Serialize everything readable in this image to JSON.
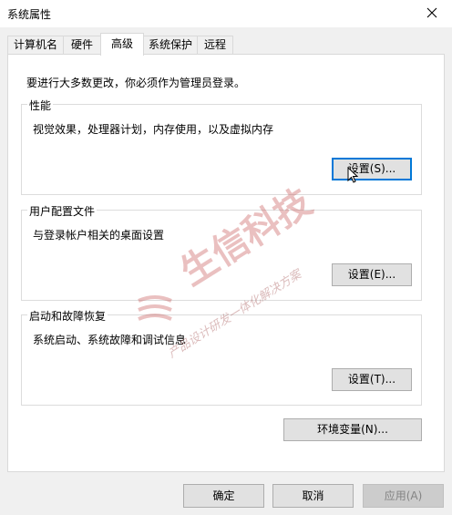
{
  "window": {
    "title": "系统属性",
    "close_glyph": "✕"
  },
  "tabs": [
    {
      "label": "计算机名",
      "active": false
    },
    {
      "label": "硬件",
      "active": false
    },
    {
      "label": "高级",
      "active": true
    },
    {
      "label": "系统保护",
      "active": false
    },
    {
      "label": "远程",
      "active": false
    }
  ],
  "admin_note": "要进行大多数更改，你必须作为管理员登录。",
  "performance": {
    "title": "性能",
    "description": "视觉效果，处理器计划，内存使用，以及虚拟内存",
    "button": "设置(S)..."
  },
  "user_profiles": {
    "title": "用户配置文件",
    "description": "与登录帐户相关的桌面设置",
    "button": "设置(E)..."
  },
  "startup_recovery": {
    "title": "启动和故障恢复",
    "description": "系统启动、系统故障和调试信息",
    "button": "设置(T)..."
  },
  "env_button": "环境变量(N)...",
  "footer": {
    "ok": "确定",
    "cancel": "取消",
    "apply": "应用(A)"
  },
  "watermark": {
    "main": "生信科技",
    "sub": "产品设计研发一体化解决方案"
  },
  "colors": {
    "focus": "#0078d7",
    "watermark": "#c54e4e"
  }
}
